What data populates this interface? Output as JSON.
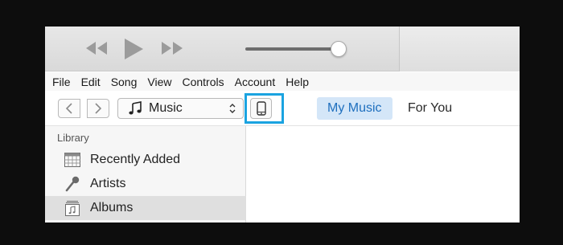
{
  "menu": [
    "File",
    "Edit",
    "Song",
    "View",
    "Controls",
    "Account",
    "Help"
  ],
  "volume_level": 0.9,
  "source": {
    "label": "Music"
  },
  "tabs": {
    "my_music": "My Music",
    "for_you": "For You"
  },
  "sidebar": {
    "section": "Library",
    "items": [
      {
        "label": "Recently Added",
        "icon": "calendar-grid-icon"
      },
      {
        "label": "Artists",
        "icon": "microphone-icon"
      },
      {
        "label": "Albums",
        "icon": "album-icon",
        "selected": true
      }
    ]
  },
  "colors": {
    "accent": "#1e6fbe",
    "highlight_border": "#1aa3e0",
    "tab_bg": "#d4e6f8"
  }
}
